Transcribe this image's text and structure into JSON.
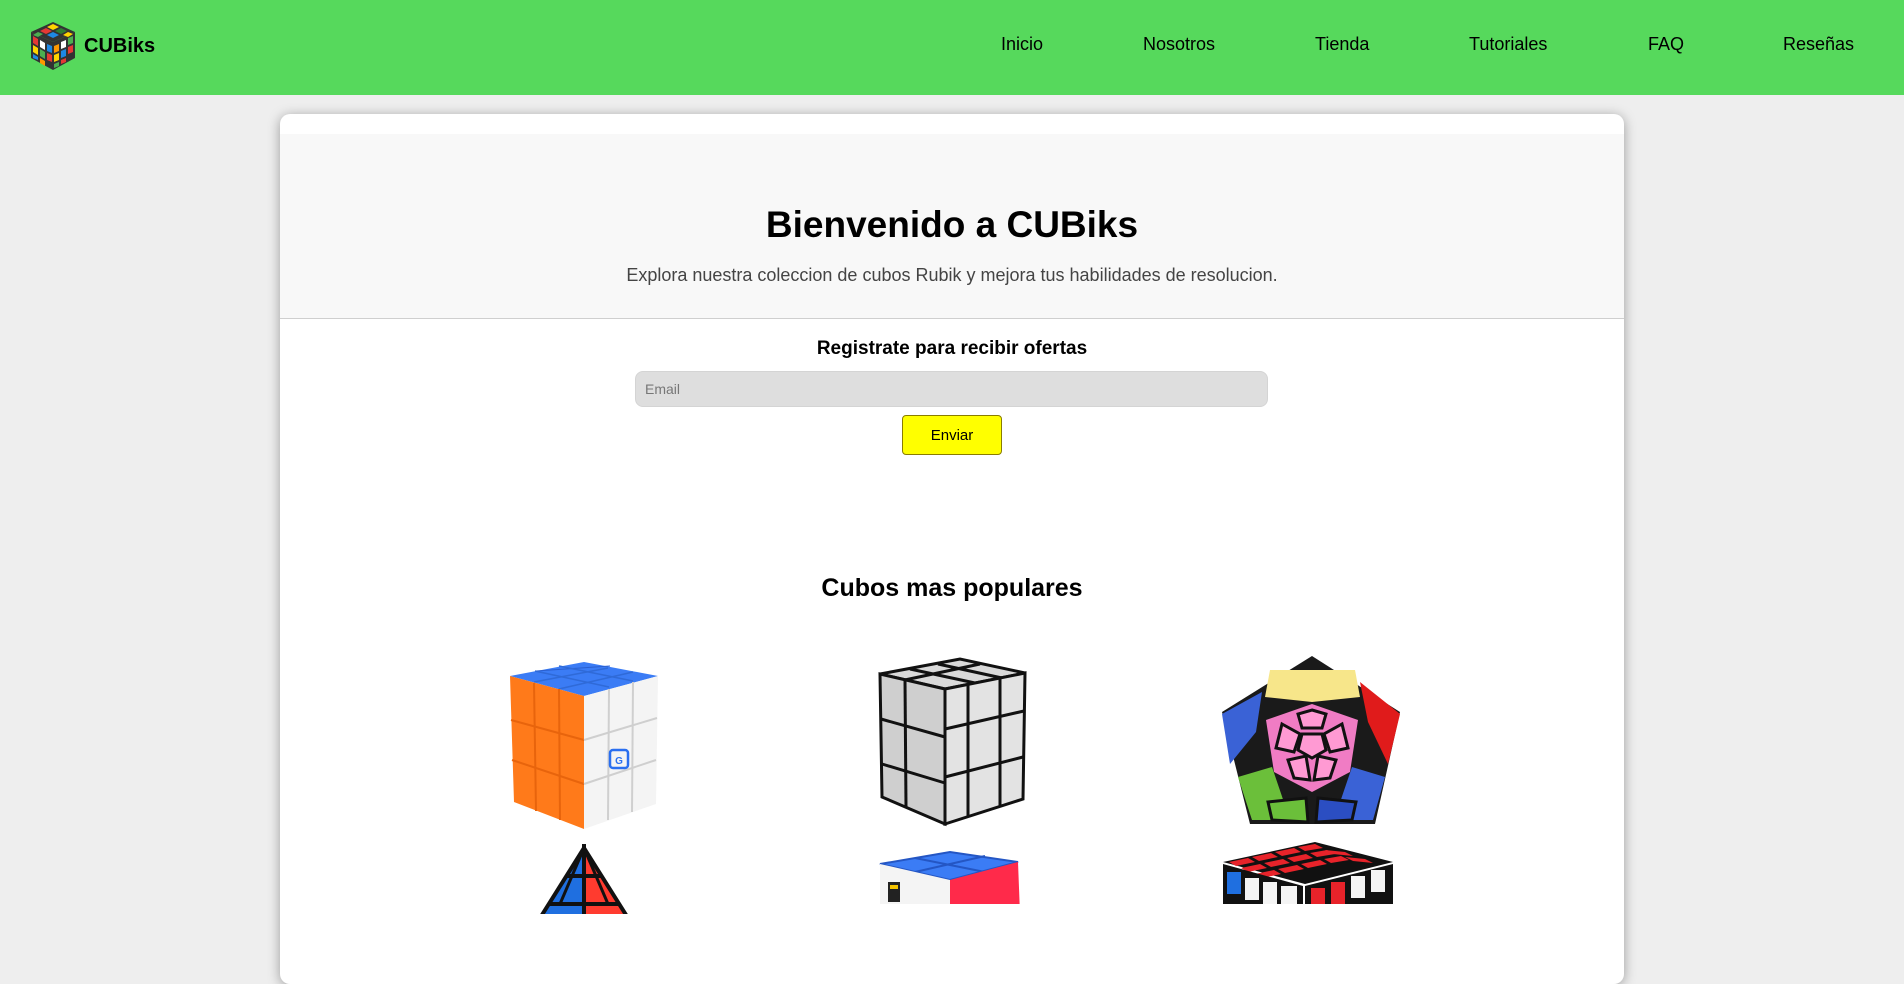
{
  "brand": {
    "name": "CUBiks",
    "logo_icon": "rubiks-cube-logo-icon"
  },
  "nav": {
    "items": [
      "Inicio",
      "Nosotros",
      "Tienda",
      "Tutoriales",
      "FAQ",
      "Reseñas"
    ]
  },
  "hero": {
    "title": "Bienvenido a CUBiks",
    "subtitle": "Explora nuestra coleccion de cubos Rubik y mejora tus habilidades de resolucion."
  },
  "signup": {
    "title": "Registrate para recibir ofertas",
    "email_placeholder": "Email",
    "email_value": "",
    "submit_label": "Enviar"
  },
  "popular": {
    "title": "Cubos mas populares",
    "products": [
      {
        "name": "gan-3x3-cube-image"
      },
      {
        "name": "mirror-cube-image"
      },
      {
        "name": "megaminx-image"
      },
      {
        "name": "pyraminx-image"
      },
      {
        "name": "square-one-cube-image"
      },
      {
        "name": "4x4-cube-image"
      }
    ]
  },
  "colors": {
    "navbar": "#56d95c",
    "background": "#eeeeee",
    "button": "#ffff00"
  }
}
